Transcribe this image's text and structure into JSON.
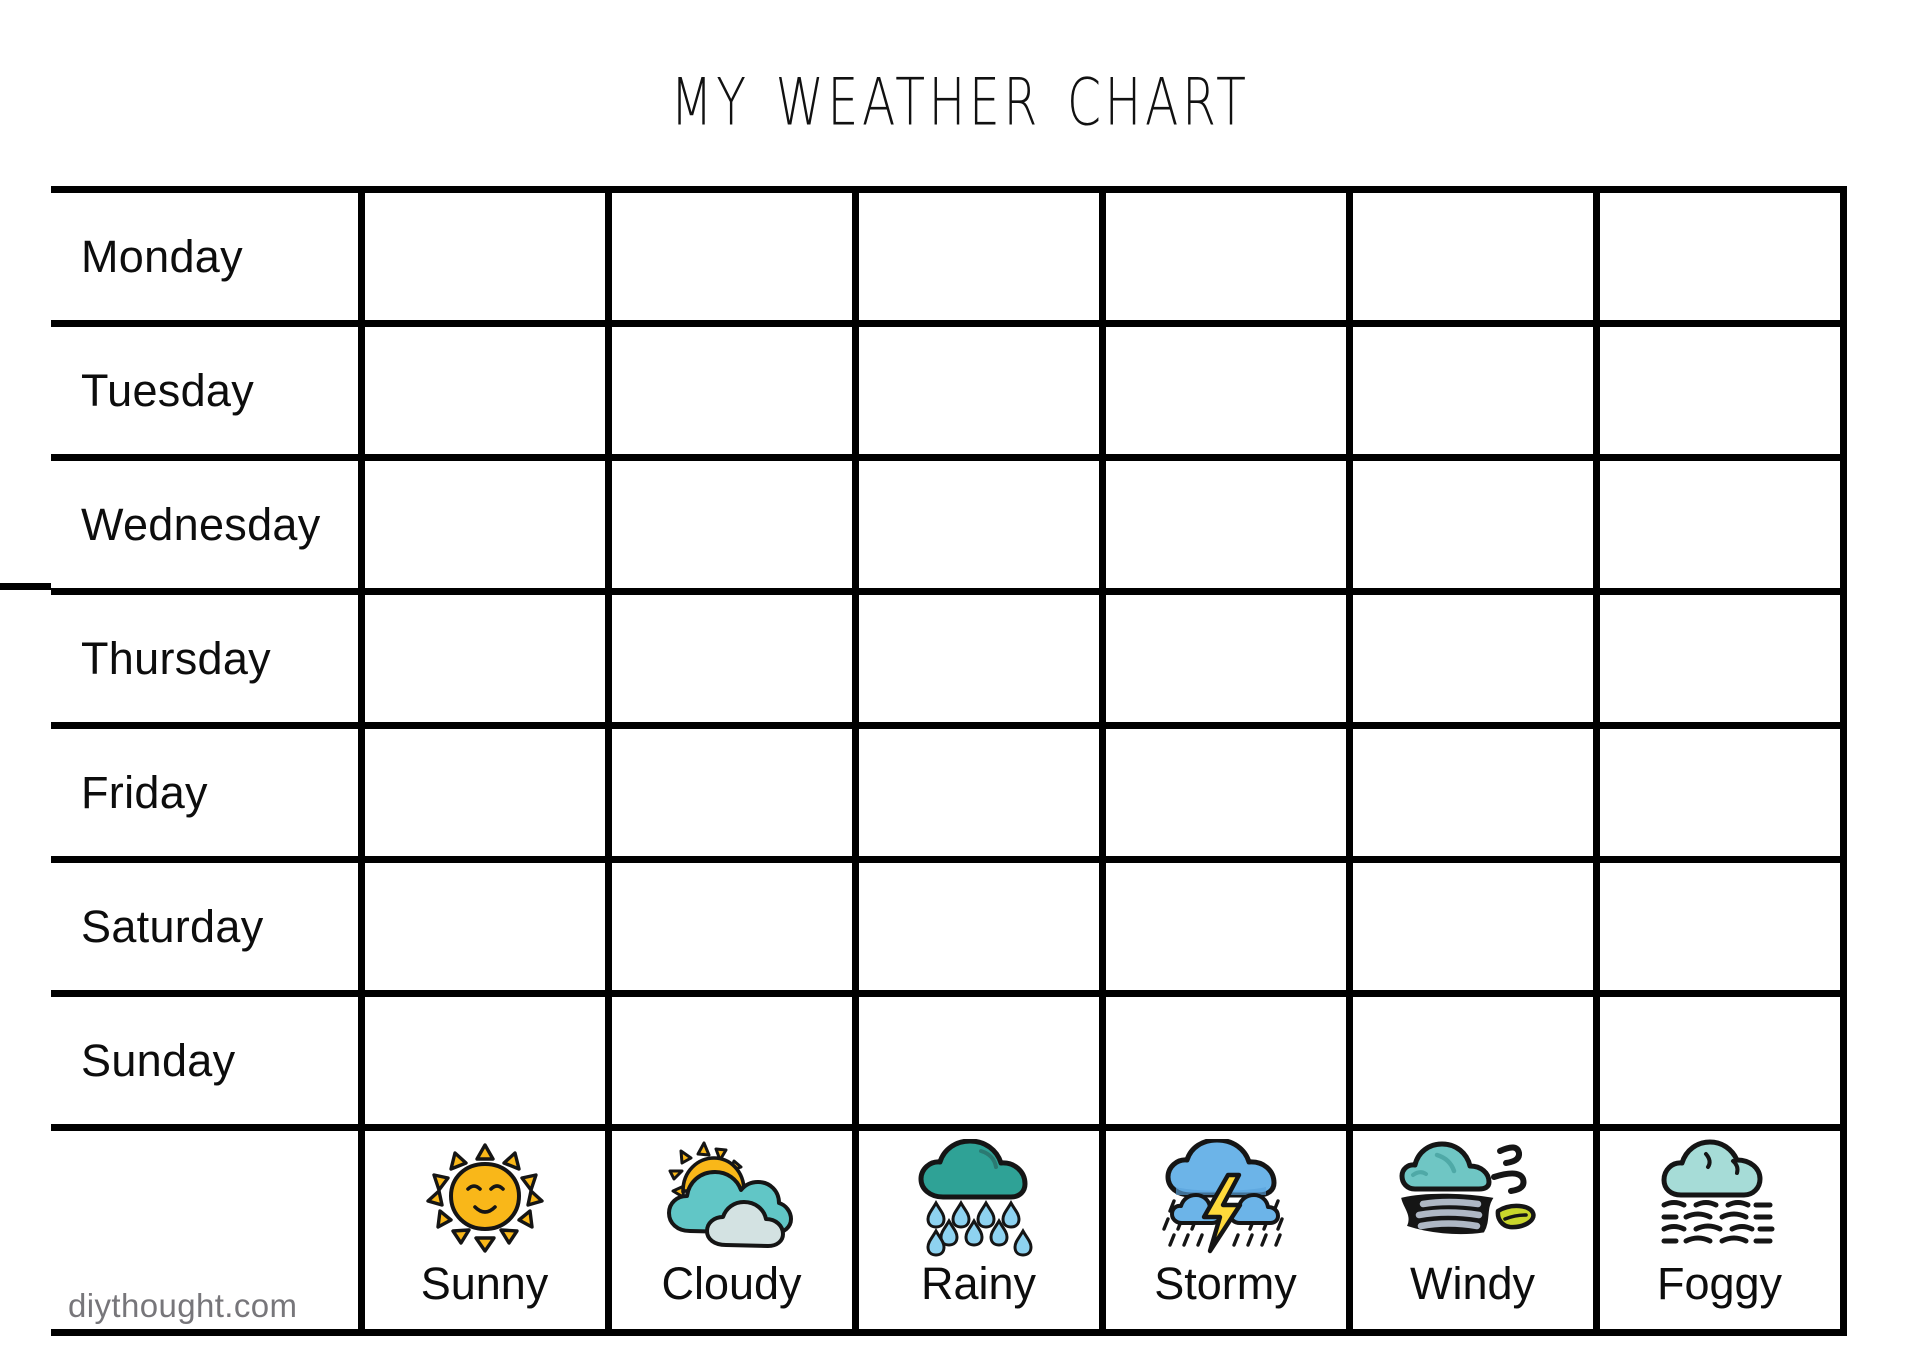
{
  "page": {
    "title": "My Weather Chart",
    "background_color": "#FFFFFF",
    "line_color": "#000000",
    "text_color": "#0D0D0D"
  },
  "watermark": {
    "text": "diythought.com",
    "color": "#77767A"
  },
  "table": {
    "columns": 7,
    "weather_columns": 6,
    "day_rows": [
      {
        "label": "Monday"
      },
      {
        "label": "Tuesday"
      },
      {
        "label": "Wednesday"
      },
      {
        "label": "Thursday"
      },
      {
        "label": "Friday"
      },
      {
        "label": "Saturday"
      },
      {
        "label": "Sunday"
      }
    ],
    "legend": [
      {
        "label": "Sunny",
        "icon": "sun-icon",
        "colors": {
          "body": "#F9B719",
          "accent": "#F9B719"
        }
      },
      {
        "label": "Cloudy",
        "icon": "sun-behind-cloud-icon",
        "colors": {
          "body": "#61C6C6",
          "accent": "#F9B719",
          "second": "#D3E2E2"
        }
      },
      {
        "label": "Rainy",
        "icon": "rain-cloud-icon",
        "colors": {
          "body": "#2FA296",
          "accent": "#8ED2F0"
        }
      },
      {
        "label": "Stormy",
        "icon": "thunderstorm-icon",
        "colors": {
          "body": "#6CB4E8",
          "accent": "#FFD93B"
        }
      },
      {
        "label": "Windy",
        "icon": "wind-icon",
        "colors": {
          "body": "#6FC6C4",
          "accent": "#C9D62C",
          "second": "#AEB7C4"
        }
      },
      {
        "label": "Foggy",
        "icon": "fog-icon",
        "colors": {
          "body": "#A6DCD7",
          "accent": "#111111"
        }
      }
    ]
  },
  "chart_data": {
    "type": "table",
    "title": "My Weather Chart",
    "description": "Blank weekly weather tracking chart. Seven day rows by six weather-type columns; all tracking cells are empty.",
    "row_headers": [
      "Monday",
      "Tuesday",
      "Wednesday",
      "Thursday",
      "Friday",
      "Saturday",
      "Sunday"
    ],
    "column_headers": [
      "Sunny",
      "Cloudy",
      "Rainy",
      "Stormy",
      "Windy",
      "Foggy"
    ],
    "values": [
      [
        "",
        "",
        "",
        "",
        "",
        ""
      ],
      [
        "",
        "",
        "",
        "",
        "",
        ""
      ],
      [
        "",
        "",
        "",
        "",
        "",
        ""
      ],
      [
        "",
        "",
        "",
        "",
        "",
        ""
      ],
      [
        "",
        "",
        "",
        "",
        "",
        ""
      ],
      [
        "",
        "",
        "",
        "",
        "",
        ""
      ],
      [
        "",
        "",
        "",
        "",
        "",
        ""
      ]
    ],
    "grid": true,
    "legend_position": "bottom"
  }
}
